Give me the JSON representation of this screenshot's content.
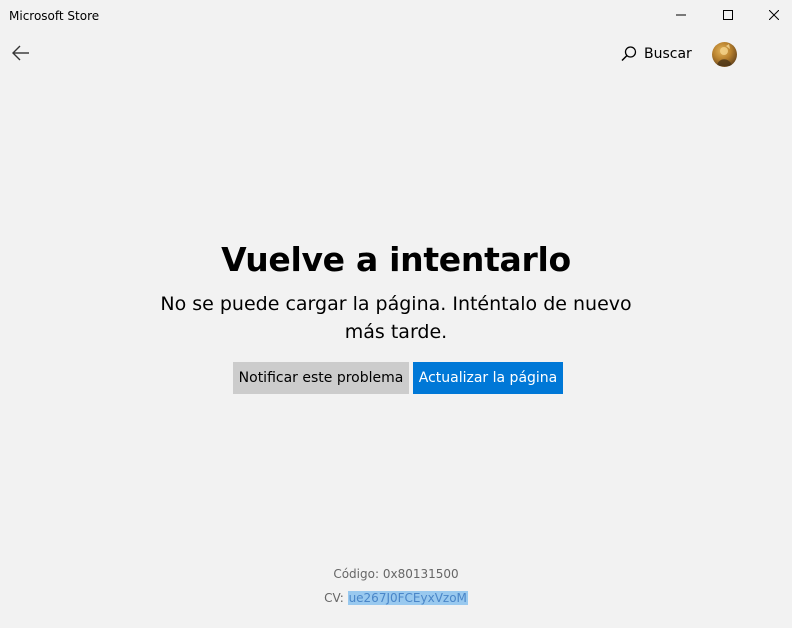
{
  "window": {
    "title": "Microsoft Store",
    "controls": {
      "minimize_icon": "minimize-icon",
      "maximize_icon": "maximize-icon",
      "close_icon": "close-icon"
    }
  },
  "nav": {
    "back_icon": "back-arrow-icon",
    "search_label": "Buscar",
    "search_icon": "search-icon",
    "avatar": "user-avatar"
  },
  "error": {
    "title": "Vuelve a intentarlo",
    "message": "No se puede cargar la página. Inténtalo de nuevo más tarde.",
    "report_button": "Notificar este problema",
    "refresh_button": "Actualizar la página"
  },
  "footer": {
    "code_label": "Código:",
    "code_value": "0x80131500",
    "cv_label": "CV:",
    "cv_value": "ue267J0FCEyxVzoM"
  },
  "colors": {
    "background": "#f2f2f2",
    "accent": "#0078d7",
    "secondary_button": "#cccccc",
    "selection": "#99c9ef"
  }
}
